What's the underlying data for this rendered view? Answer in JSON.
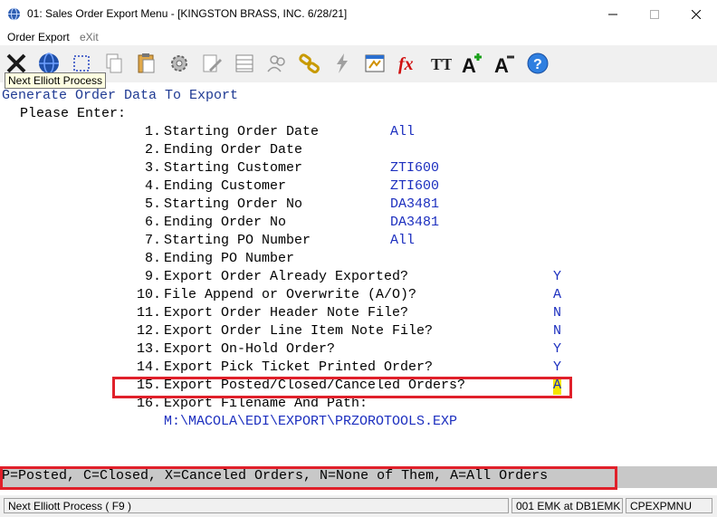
{
  "window": {
    "title": "01: Sales Order Export Menu - [KINGSTON BRASS, INC. 6/28/21]",
    "minimize_glyph": "—",
    "maximize_glyph": "☐",
    "close_glyph": "✕"
  },
  "menu": {
    "order_export": "Order Export",
    "exit": "eXit"
  },
  "toolbar": {
    "icons": [
      "close-x-icon",
      "globe-icon",
      "select-box-icon",
      "copy-icon",
      "paste-icon",
      "settings-gear-icon",
      "edit-doc-icon",
      "grid-icon",
      "users-icon",
      "chain-link-icon",
      "lightning-icon",
      "spreadsheet-icon",
      "function-icon",
      "text-size-icon",
      "font-increase-icon",
      "font-decrease-icon",
      "help-icon"
    ],
    "fx_label": "fx",
    "tt_label": "TT",
    "a_label": "A",
    "help_label": "?",
    "tooltip": "Next Elliott Process"
  },
  "form": {
    "heading": "Generate Order Data To Export",
    "prompt": "Please Enter:",
    "fields": [
      {
        "num": " 1.",
        "label": "Starting Order Date",
        "value": "All"
      },
      {
        "num": " 2.",
        "label": "Ending Order Date",
        "value": ""
      },
      {
        "num": " 3.",
        "label": "Starting Customer",
        "value": "ZTI600"
      },
      {
        "num": " 4.",
        "label": "Ending Customer",
        "value": "ZTI600"
      },
      {
        "num": " 5.",
        "label": "Starting Order No",
        "value": "DA3481"
      },
      {
        "num": " 6.",
        "label": "Ending Order No",
        "value": "DA3481"
      },
      {
        "num": " 7.",
        "label": "Starting PO Number",
        "value": "All"
      },
      {
        "num": " 8.",
        "label": "Ending PO Number",
        "value": ""
      },
      {
        "num": " 9.",
        "label": "Export Order Already Exported?",
        "value": "Y"
      },
      {
        "num": "10.",
        "label": "File Append or Overwrite (A/O)?",
        "value": "A"
      },
      {
        "num": "11.",
        "label": "Export Order Header Note File?",
        "value": "N"
      },
      {
        "num": "12.",
        "label": "Export Order Line Item Note File?",
        "value": "N"
      },
      {
        "num": "13.",
        "label": "Export On-Hold Order?",
        "value": "Y"
      },
      {
        "num": "14.",
        "label": "Export Pick Ticket Printed Order?",
        "value": "Y"
      },
      {
        "num": "15.",
        "label": "Export Posted/Closed/Canceled Orders?",
        "value": "A"
      },
      {
        "num": "16.",
        "label": "Export Filename And Path:",
        "value": ""
      }
    ],
    "path_value": "M:\\MACOLA\\EDI\\EXPORT\\PRZOROTOOLS.EXP"
  },
  "help_line": "P=Posted, C=Closed, X=Canceled Orders, N=None of Them, A=All Orders",
  "status": {
    "left": "Next Elliott Process ( F9 )",
    "middle": "001 EMK at DB1EMK",
    "right": "CPEXPMNU"
  },
  "colors": {
    "heading": "#1f3a93",
    "value": "#1c2fbf",
    "highlight_border": "#e0202a",
    "cursor": "#f5e600",
    "help_bg": "#c8c8c8"
  }
}
